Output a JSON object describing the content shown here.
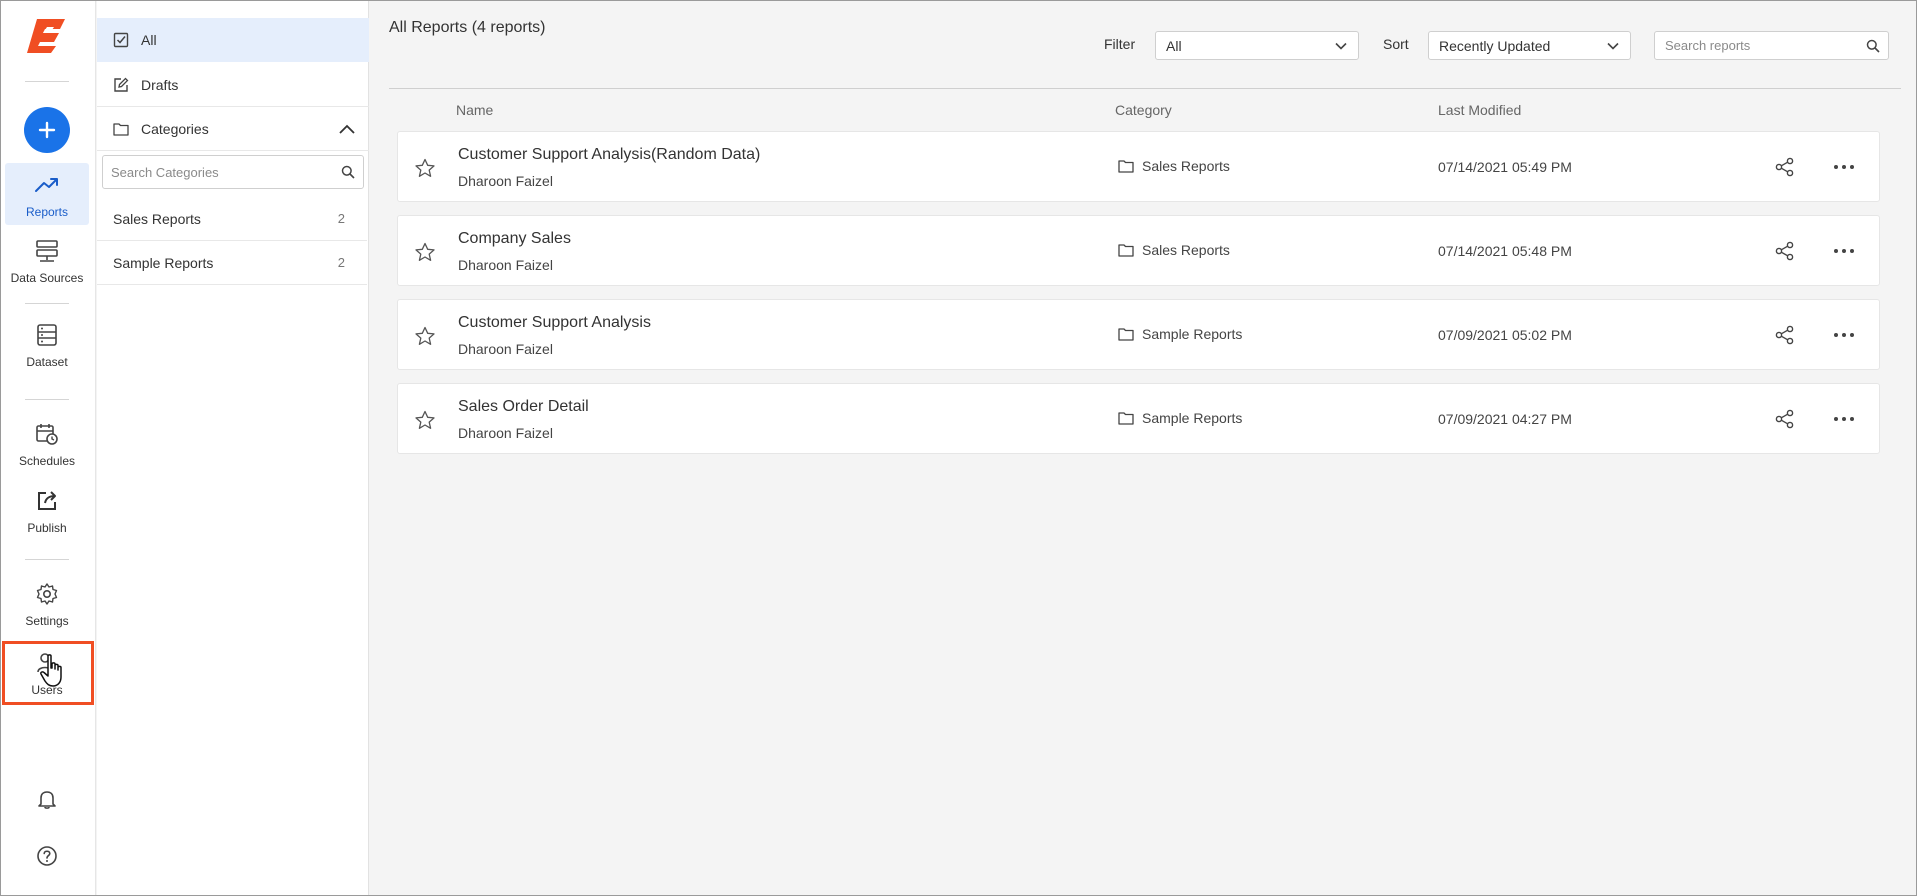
{
  "nav": {
    "items": [
      {
        "id": "reports",
        "label": "Reports"
      },
      {
        "id": "data-sources",
        "label": "Data Sources"
      },
      {
        "id": "dataset",
        "label": "Dataset"
      },
      {
        "id": "schedules",
        "label": "Schedules"
      },
      {
        "id": "publish",
        "label": "Publish"
      },
      {
        "id": "settings",
        "label": "Settings"
      },
      {
        "id": "users",
        "label": "Users"
      }
    ],
    "accent_color": "#1a73e8",
    "highlight_color": "#f04e23",
    "logo_color": "#f04e23"
  },
  "categories_panel": {
    "all_label": "All",
    "drafts_label": "Drafts",
    "categories_label": "Categories",
    "search_placeholder": "Search Categories",
    "items": [
      {
        "name": "Sales Reports",
        "count": "2"
      },
      {
        "name": "Sample Reports",
        "count": "2"
      }
    ]
  },
  "main": {
    "title": "All Reports (4 reports)",
    "filter_label": "Filter",
    "filter_value": "All",
    "sort_label": "Sort",
    "sort_value": "Recently Updated",
    "search_placeholder": "Search reports",
    "columns": {
      "name": "Name",
      "category": "Category",
      "last_modified": "Last Modified"
    },
    "reports": [
      {
        "name": "Customer Support Analysis(Random Data)",
        "owner": "Dharoon Faizel",
        "category": "Sales Reports",
        "modified": "07/14/2021 05:49 PM"
      },
      {
        "name": "Company Sales",
        "owner": "Dharoon Faizel",
        "category": "Sales Reports",
        "modified": "07/14/2021 05:48 PM"
      },
      {
        "name": "Customer Support Analysis",
        "owner": "Dharoon Faizel",
        "category": "Sample Reports",
        "modified": "07/09/2021 05:02 PM"
      },
      {
        "name": "Sales Order Detail",
        "owner": "Dharoon Faizel",
        "category": "Sample Reports",
        "modified": "07/09/2021 04:27 PM"
      }
    ]
  }
}
